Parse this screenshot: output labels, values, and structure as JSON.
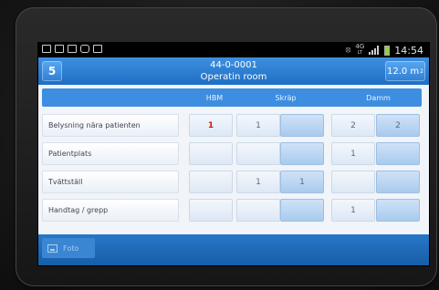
{
  "status_bar": {
    "network_type": "4G",
    "network_sub": "LT",
    "time": "14:54"
  },
  "app_bar": {
    "room_number": "5",
    "room_code": "44-0-0001",
    "room_name": "Operatin room",
    "area_value": "12.0 m",
    "area_unit_exp": "2"
  },
  "table": {
    "columns": [
      "HBM",
      "Skräp",
      "Damm"
    ],
    "rows": [
      {
        "label": "Belysning nära patienten",
        "cells": [
          "1",
          "1",
          "",
          "2",
          "2"
        ]
      },
      {
        "label": "Patientplats",
        "cells": [
          "",
          "",
          "",
          "1",
          ""
        ]
      },
      {
        "label": "Tvättställ",
        "cells": [
          "",
          "1",
          "1",
          "",
          ""
        ]
      },
      {
        "label": "Handtag / grepp",
        "cells": [
          "",
          "",
          "",
          "1",
          ""
        ]
      }
    ]
  },
  "bottom_bar": {
    "photo_label": "Foto"
  },
  "colors": {
    "accent": "#1e6fc4",
    "alert_value": "#e01010"
  },
  "icons": [
    "email-icon",
    "gmail-icon",
    "gallery-icon",
    "camera-icon",
    "calendar-icon",
    "signal-icon",
    "battery-icon",
    "photo-icon"
  ]
}
